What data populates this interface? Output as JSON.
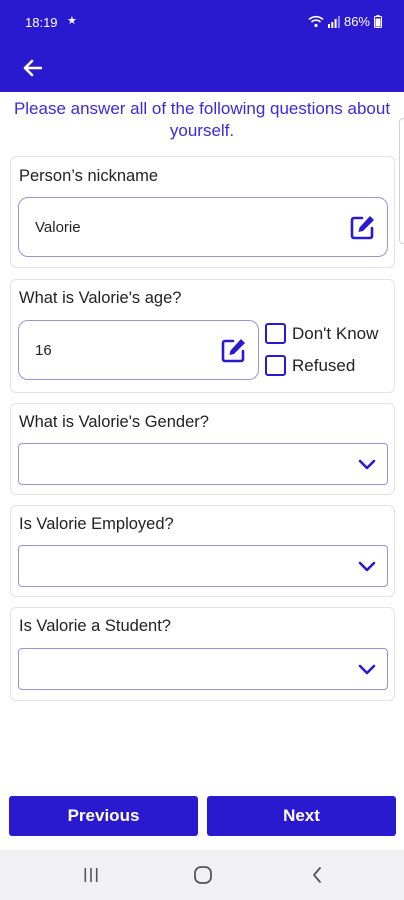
{
  "status_bar": {
    "time": "18:19",
    "battery": "86%",
    "icons": [
      "star-icon",
      "wifi-icon",
      "signal-icon",
      "battery-icon"
    ]
  },
  "app_bar": {
    "back_icon": "arrow-left-icon"
  },
  "instruction": "Please answer all of the following questions about yourself.",
  "questions": {
    "nickname": {
      "label": "Person’s nickname",
      "value": "Valorie",
      "icon": "edit-icon"
    },
    "age": {
      "label": "What is Valorie's age?",
      "value": "16",
      "icon": "edit-icon",
      "dont_know": "Don't Know",
      "refused": "Refused"
    },
    "gender": {
      "label": "What is Valorie's Gender?",
      "value": ""
    },
    "employed": {
      "label": "Is Valorie Employed?",
      "value": ""
    },
    "student": {
      "label": "Is Valorie a Student?",
      "value": ""
    }
  },
  "buttons": {
    "previous": "Previous",
    "next": "Next"
  },
  "nav_bar": {
    "icons": [
      "recents-icon",
      "home-icon",
      "back-icon"
    ]
  },
  "colors": {
    "primary": "#2a1acf",
    "instruction_text": "#3a2bd8",
    "input_border": "#9a93d9"
  }
}
